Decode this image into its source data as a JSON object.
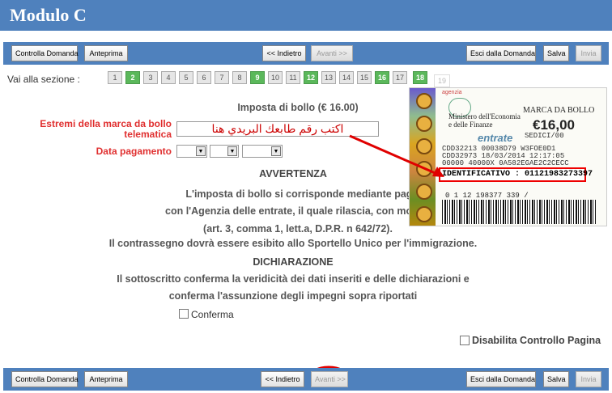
{
  "title": "Modulo C",
  "toolbar": {
    "check": "Controlla Domanda",
    "preview": "Anteprima",
    "back": "<< Indietro",
    "next": ">>",
    "next_label": "Avanti >>",
    "exit": "Esci dalla Domanda",
    "save": "Salva",
    "send": "Invia"
  },
  "sections": {
    "label": "Vai alla sezione :",
    "items": [
      "1",
      "2",
      "3",
      "4",
      "5",
      "6",
      "7",
      "8",
      "9",
      "10",
      "11",
      "12",
      "13",
      "14",
      "15",
      "16",
      "17",
      "18",
      "19"
    ],
    "completed": [
      "2",
      "9",
      "12",
      "16",
      "18"
    ],
    "current": "19"
  },
  "form": {
    "heading": "Imposta di bollo (€ 16.00)",
    "stamp_label_1": "Estremi della marca da bollo",
    "stamp_label_2": "telematica",
    "stamp_value": "اكتب رقم طابعك البريدي هنا",
    "date_label": "Data pagamento"
  },
  "notice": {
    "title": "AVVERTENZA",
    "line1": "L'imposta di bollo si corrisponde mediante pagamento ad intermedia",
    "line2": "con l'Agenzia delle entrate, il quale rilascia, con modalità telematiche, a",
    "line3": "(art. 3, comma 1, lett.a, D.P.R. n 642/72).",
    "line4": "Il contrassegno dovrà essere esibito allo Sportello Unico per l'immigrazione."
  },
  "declaration": {
    "title": "DICHIARAZIONE",
    "line1": "Il sottoscritto conferma la veridicità dei dati inseriti e delle dichiarazioni e",
    "line2": "conferma l'assunzione degli impegni sopra riportati",
    "confirm": "Conferma"
  },
  "disable_check": "Disabilita Controllo Pagina",
  "stamp_image": {
    "brand": "agenzia",
    "ministry_1": "Ministero dell'Economia",
    "ministry_2": "e delle Finanze",
    "marca": "MARCA DA BOLLO",
    "price": "€16,00",
    "code_top": "SEDICI/00",
    "entrate": "entrate",
    "row1": "CDD32213   00038D79   W3FOE0D1",
    "row2": "CDD32973   18/03/2014 12:17:05",
    "row3": "00000 40000X   0A582EGAE2C2CECC",
    "identificativo": "IDENTIFICATIVO : 01121983273397",
    "barnum": "0 1 12  198377 339 /"
  },
  "colors": {
    "header": "#4f81bd",
    "completed": "#5bb85b",
    "label_red": "#e03030",
    "annotation": "#e00000"
  }
}
